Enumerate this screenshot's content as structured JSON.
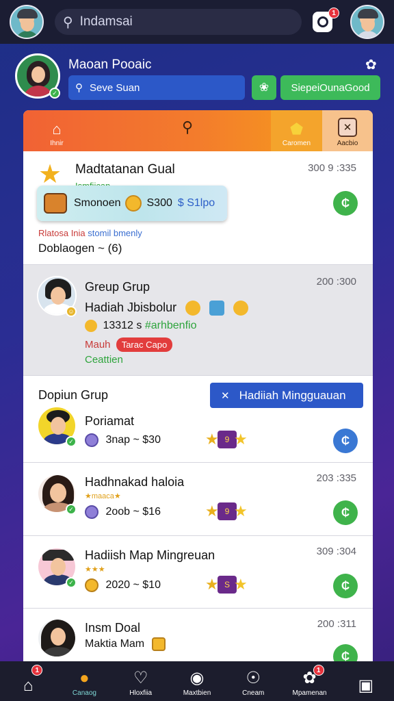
{
  "header": {
    "search_text": "Indamsai",
    "notification_count": "1"
  },
  "profile": {
    "name": "Maoan Pooaic",
    "search_label": "Seve Suan",
    "cta_label": "SiepeiOunaGood"
  },
  "panel_tabs": [
    {
      "label": "Ihnir",
      "icon": "home-icon"
    },
    {
      "label": "",
      "icon": "search-icon"
    },
    {
      "label": "Caromen",
      "icon": "badge-icon"
    },
    {
      "label": "Aacbio",
      "icon": "tools-icon"
    }
  ],
  "cards": {
    "c1": {
      "title": "Madtatanan Gual",
      "time": "300 9 :335",
      "subtitle": "Ismfiican",
      "pill_label": "Smonoen",
      "pill_amount": "S300",
      "pill_price": "$ S1lpo",
      "red_text": "Rlatosa Inia",
      "blue_text": "stomil bmenly",
      "drop_label": "Doblaogen ~ (6)"
    },
    "c2": {
      "title": "Greup Grup",
      "time": "200 :300",
      "line1": "Hadiah Jbisbolur",
      "line2_num": "13312 s",
      "line2_green": "#arhbenfio",
      "line3": "Mauh",
      "tag": "Tarac Capo",
      "line4": "Ceattien"
    },
    "c3": {
      "section": "Dopiun Grup",
      "cta": "Hadiiah Mingguauan",
      "name": "Poriamat",
      "stat": "3nap ~ $30",
      "reward": "9"
    },
    "c4": {
      "name": "Hadhnakad haloia",
      "time": "203 :335",
      "stars": "★maaca★",
      "stat": "2oob ~ $16",
      "reward": "9"
    },
    "c5": {
      "name": "Hadiish Map Mingreuan",
      "time": "309 :304",
      "stars": "★★★",
      "stat": "2020 ~ $10",
      "reward": "S"
    },
    "c6": {
      "name": "Insm Doal",
      "time": "200 :311",
      "stat": "Maktia Mam"
    }
  },
  "bottom_nav": [
    {
      "label": "",
      "icon": "home-icon",
      "badge": "1"
    },
    {
      "label": "Canaog",
      "icon": "chat-icon",
      "badge": ""
    },
    {
      "label": "Hloxfiia",
      "icon": "heart-chat-icon",
      "badge": ""
    },
    {
      "label": "Maxtbien",
      "icon": "camera-icon",
      "badge": ""
    },
    {
      "label": "Cneam",
      "icon": "tools-icon",
      "badge": ""
    },
    {
      "label": "Mpamenan",
      "icon": "gift-icon",
      "badge": "1"
    },
    {
      "label": "",
      "icon": "share-icon",
      "badge": ""
    }
  ],
  "colors": {
    "accent_green": "#3dba5a",
    "accent_blue": "#2c58c8",
    "tab_orange": "#f37c2c",
    "badge_red": "#e6323c"
  }
}
